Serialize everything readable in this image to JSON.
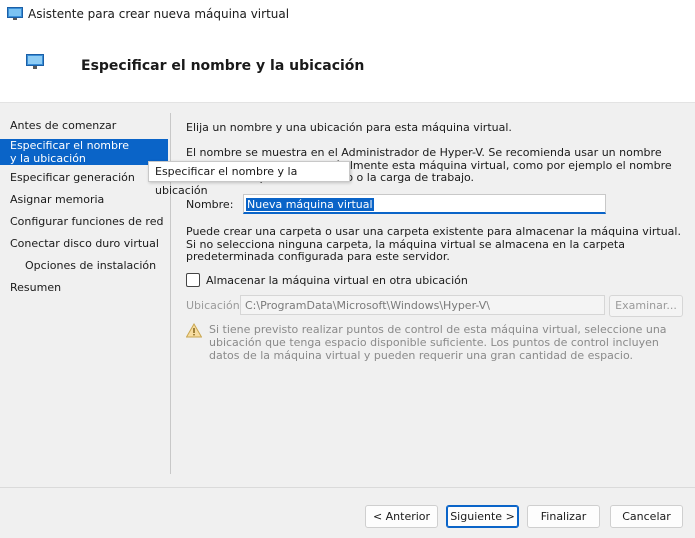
{
  "window": {
    "title": "Asistente para crear nueva máquina virtual",
    "icon": "monitor-icon"
  },
  "header": {
    "title": "Especificar el nombre y la ubicación",
    "icon": "monitor-icon"
  },
  "nav": {
    "items": [
      {
        "label": "Antes de comenzar"
      },
      {
        "label": "Especificar el nombre y la ubicación"
      },
      {
        "label": "Especificar generación"
      },
      {
        "label": "Asignar memoria"
      },
      {
        "label": "Configurar funciones de red"
      },
      {
        "label": "Conectar disco duro virtual"
      },
      {
        "label": "Opciones de instalación"
      },
      {
        "label": "Resumen"
      }
    ],
    "active_index": 1
  },
  "tooltip": "Especificar el nombre y la ubicación",
  "content": {
    "intro": "Elija un nombre y una ubicación para esta máquina virtual.",
    "name_help": "El nombre se muestra en el Administrador de Hyper-V. Se recomienda usar un nombre que le ayude a identificar fácilmente esta máquina virtual, como por ejemplo el nombre del sistema operativo invitado o la carga de trabajo.",
    "name_label": "Nombre:",
    "name_value": "Nueva máquina virtual",
    "folder_help": "Puede crear una carpeta o usar una carpeta existente para almacenar la máquina virtual. Si no selecciona ninguna carpeta, la máquina virtual se almacena en la carpeta predeterminada configurada para este servidor.",
    "store_checkbox_label": "Almacenar la máquina virtual en otra ubicación",
    "store_checked": false,
    "location_label": "Ubicación:",
    "location_value": "C:\\ProgramData\\Microsoft\\Windows\\Hyper-V\\",
    "browse_label": "Examinar...",
    "warning_icon": "warning-icon",
    "warning_text": "Si tiene previsto realizar puntos de control de esta máquina virtual, seleccione una ubicación que tenga espacio disponible suficiente. Los puntos de control incluyen datos de la máquina virtual y pueden requerir una gran cantidad de espacio."
  },
  "buttons": {
    "back": "< Anterior",
    "next": "Siguiente >",
    "finish": "Finalizar",
    "cancel": "Cancelar"
  },
  "colors": {
    "accent": "#0a64c8",
    "background": "#f0f0f0"
  }
}
